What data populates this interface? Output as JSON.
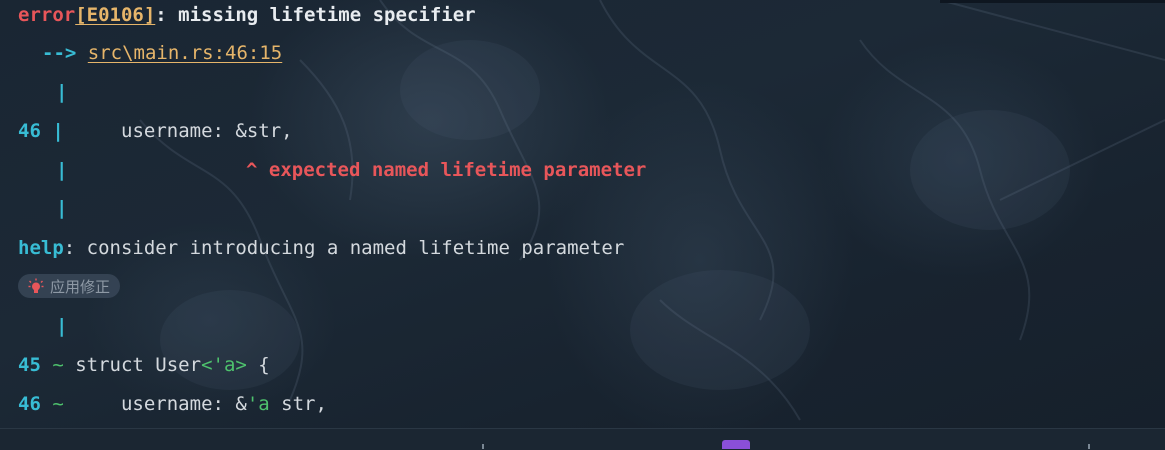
{
  "diagnostic": {
    "severity": "error",
    "code": "[E0106]",
    "message": ": missing lifetime specifier",
    "location_arrow": "-->",
    "location": "src\\main.rs:46:15",
    "pipe": "|",
    "source_line_number": "46",
    "source_code": "    username: &str,",
    "caret": "^ expected named lifetime parameter",
    "help_label": "help",
    "help_message": ": consider introducing a named lifetime parameter",
    "fix_button_label": "应用修正",
    "suggestion": [
      {
        "line_number": "45",
        "marker": "~",
        "pre": " struct User",
        "highlight": "<'a>",
        "post": " {"
      },
      {
        "line_number": "46",
        "marker": "~",
        "pre": "     username: &",
        "highlight": "'a",
        "post": " str,"
      }
    ]
  },
  "colors": {
    "error": "#e8565a",
    "accent_cyan": "#38bcd4",
    "link": "#e6b56a",
    "addition_green": "#4ec26d",
    "background": "#17232f"
  },
  "icons": {
    "fix": "lightbulb-icon"
  }
}
